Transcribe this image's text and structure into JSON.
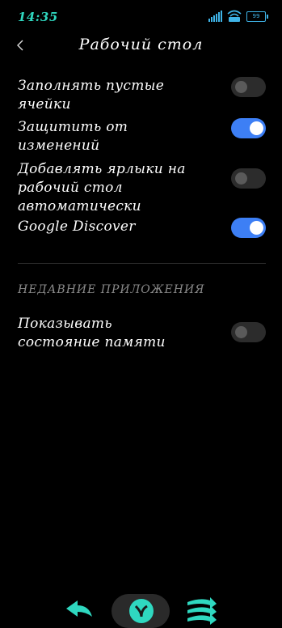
{
  "status_bar": {
    "time": "14:35",
    "battery": "99"
  },
  "header": {
    "title": "Рабочий стол"
  },
  "settings": [
    {
      "label": "Заполнять пустые ячейки",
      "enabled": false
    },
    {
      "label": "Защитить от изменений",
      "enabled": true
    },
    {
      "label": "Добавлять ярлыки на рабочий стол автоматически",
      "enabled": false
    },
    {
      "label": "Google Discover",
      "enabled": true
    }
  ],
  "recent_apps": {
    "section_title": "НЕДАВНИЕ ПРИЛОЖЕНИЯ",
    "items": [
      {
        "label": "Показывать состояние памяти",
        "enabled": false
      }
    ]
  },
  "colors": {
    "accent": "#3d7ff5",
    "nav_accent": "#2fd8c0",
    "status_blue": "#3fb4e8"
  }
}
